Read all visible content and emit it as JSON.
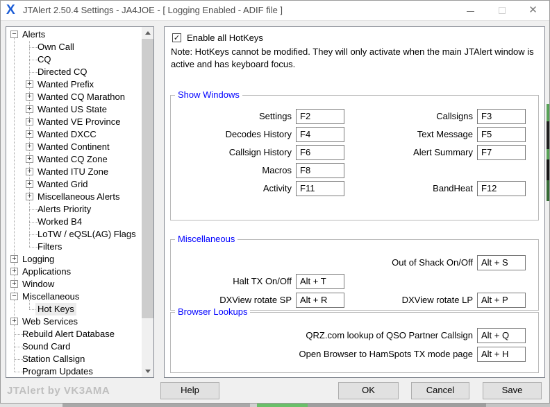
{
  "titlebar": {
    "title": "JTAlert 2.50.4 Settings  -  JA4JOE  -  [ Logging Enabled - ADIF file ]",
    "logo_glyph": "X",
    "close_glyph": "✕"
  },
  "icons": {
    "checkmark": "✓",
    "expander_open": "−",
    "expander_closed": "+"
  },
  "tree": {
    "items": [
      {
        "label": "Alerts",
        "expander": "minus",
        "level": 0,
        "selected": false
      },
      {
        "label": "Own Call",
        "expander": "none",
        "level": 1,
        "selected": false
      },
      {
        "label": "CQ",
        "expander": "none",
        "level": 1,
        "selected": false
      },
      {
        "label": "Directed CQ",
        "expander": "none",
        "level": 1,
        "selected": false
      },
      {
        "label": "Wanted Prefix",
        "expander": "plus",
        "level": 1,
        "selected": false
      },
      {
        "label": "Wanted CQ Marathon",
        "expander": "plus",
        "level": 1,
        "selected": false
      },
      {
        "label": "Wanted US State",
        "expander": "plus",
        "level": 1,
        "selected": false
      },
      {
        "label": "Wanted VE Province",
        "expander": "plus",
        "level": 1,
        "selected": false
      },
      {
        "label": "Wanted DXCC",
        "expander": "plus",
        "level": 1,
        "selected": false
      },
      {
        "label": "Wanted Continent",
        "expander": "plus",
        "level": 1,
        "selected": false
      },
      {
        "label": "Wanted CQ Zone",
        "expander": "plus",
        "level": 1,
        "selected": false
      },
      {
        "label": "Wanted ITU Zone",
        "expander": "plus",
        "level": 1,
        "selected": false
      },
      {
        "label": "Wanted Grid",
        "expander": "plus",
        "level": 1,
        "selected": false
      },
      {
        "label": "Miscellaneous Alerts",
        "expander": "plus",
        "level": 1,
        "selected": false
      },
      {
        "label": "Alerts Priority",
        "expander": "none",
        "level": 1,
        "selected": false
      },
      {
        "label": "Worked B4",
        "expander": "none",
        "level": 1,
        "selected": false
      },
      {
        "label": "LoTW / eQSL(AG) Flags",
        "expander": "none",
        "level": 1,
        "selected": false
      },
      {
        "label": "Filters",
        "expander": "none",
        "level": 1,
        "selected": false
      },
      {
        "label": "Logging",
        "expander": "plus",
        "level": 0,
        "selected": false
      },
      {
        "label": "Applications",
        "expander": "plus",
        "level": 0,
        "selected": false
      },
      {
        "label": "Window",
        "expander": "plus",
        "level": 0,
        "selected": false
      },
      {
        "label": "Miscellaneous",
        "expander": "minus",
        "level": 0,
        "selected": false
      },
      {
        "label": "Hot Keys",
        "expander": "none",
        "level": 1,
        "selected": true
      },
      {
        "label": "Web Services",
        "expander": "plus",
        "level": 0,
        "selected": false
      },
      {
        "label": "Rebuild Alert Database",
        "expander": "none",
        "level": 0,
        "selected": false
      },
      {
        "label": "Sound Card",
        "expander": "none",
        "level": 0,
        "selected": false
      },
      {
        "label": "Station Callsign",
        "expander": "none",
        "level": 0,
        "selected": false
      },
      {
        "label": "Program Updates",
        "expander": "none",
        "level": 0,
        "selected": false
      }
    ]
  },
  "main": {
    "enable_hotkeys": {
      "checked": true,
      "label": "Enable all HotKeys"
    },
    "note": "Note: HotKeys cannot be modified. They will only activate when the main JTAlert window is active and has keyboard focus.",
    "groups": [
      {
        "title": "Show Windows",
        "rows": [
          {
            "left": {
              "label": "Settings",
              "key": "F2"
            },
            "right": {
              "label": "Callsigns",
              "key": "F3"
            }
          },
          {
            "left": {
              "label": "Decodes History",
              "key": "F4"
            },
            "right": {
              "label": "Text Message",
              "key": "F5"
            }
          },
          {
            "left": {
              "label": "Callsign History",
              "key": "F6"
            },
            "right": {
              "label": "Alert Summary",
              "key": "F7"
            }
          },
          {
            "left": {
              "label": "Macros",
              "key": "F8"
            }
          },
          {
            "left": {
              "label": "Activity",
              "key": "F11"
            },
            "right": {
              "label": "BandHeat",
              "key": "F12"
            }
          }
        ]
      },
      {
        "title": "Miscellaneous",
        "rows": [
          {
            "right": {
              "label": "Out of Shack On/Off",
              "key": "Alt + S"
            }
          },
          {
            "left": {
              "label": "Halt TX On/Off",
              "key": "Alt + T"
            }
          },
          {
            "left": {
              "label": "DXView rotate SP",
              "key": "Alt + R"
            },
            "right": {
              "label": "DXView rotate LP",
              "key": "Alt + P"
            }
          }
        ]
      },
      {
        "title": "Browser Lookups",
        "rows": [
          {
            "right": {
              "label": "QRZ.com lookup of QSO Partner Callsign",
              "key": "Alt + Q"
            }
          },
          {
            "right": {
              "label": "Open Browser to HamSpots TX mode page",
              "key": "Alt + H"
            }
          }
        ]
      }
    ]
  },
  "footer": {
    "brand": "JTAlert by VK3AMA",
    "help_label": "Help",
    "ok_label": "OK",
    "cancel_label": "Cancel",
    "save_label": "Save"
  },
  "colors": {
    "group_title_blue": "#0000ff",
    "logo_blue": "#1b5cd6",
    "selection_gray": "#ececec",
    "panel_border": "#828790"
  }
}
